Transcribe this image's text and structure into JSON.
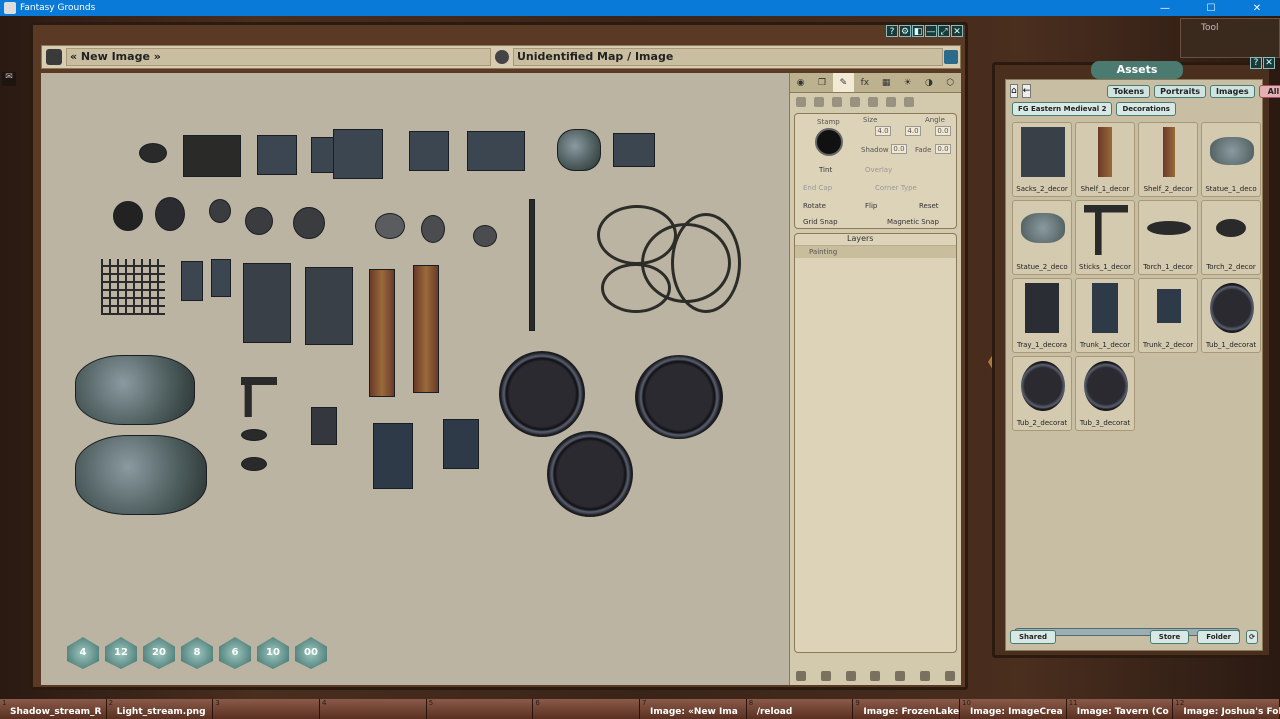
{
  "os_window": {
    "title": "Fantasy Grounds",
    "controls": [
      "—",
      "☐",
      "✕"
    ]
  },
  "image_window": {
    "name_field": "« New Image »",
    "type_field": "Unidentified Map / Image",
    "controls": [
      "?",
      "⚙",
      "◧",
      "—",
      "⤢",
      "✕"
    ]
  },
  "dice": [
    "4",
    "12",
    "20",
    "8",
    "6",
    "10",
    "00"
  ],
  "palette": {
    "stamp": {
      "stamp_label": "Stamp",
      "size_label": "Size",
      "angle_label": "Angle",
      "size_w": "4.0",
      "size_h": "4.0",
      "angle": "0.0",
      "shadow_label": "Shadow",
      "shadow": "0.0",
      "fade_label": "Fade",
      "fade": "0.0",
      "tint_label": "Tint",
      "overlay_label": "Overlay",
      "end_cap_label": "End Cap",
      "corner_type_label": "Corner Type",
      "rotate_label": "Rotate",
      "flip_label": "Flip",
      "reset_label": "Reset",
      "grid_snap_label": "Grid Snap",
      "magnetic_snap_label": "Magnetic Snap"
    },
    "layers": {
      "title": "Layers",
      "row": "Painting"
    }
  },
  "tool_panel": {
    "label": "Tool"
  },
  "assets": {
    "title": "Assets",
    "tabs": [
      "Tokens",
      "Portraits",
      "Images",
      "All"
    ],
    "breadcrumbs": [
      "FG Eastern Medieval 2",
      "Decorations"
    ],
    "items": [
      "Sacks_2_decor",
      "Shelf_1_decor",
      "Shelf_2_decor",
      "Statue_1_deco",
      "Statue_2_deco",
      "Sticks_1_decor",
      "Torch_1_decor",
      "Torch_2_decor",
      "Tray_1_decora",
      "Trunk_1_decor",
      "Trunk_2_decor",
      "Tub_1_decorat",
      "Tub_2_decorat",
      "Tub_3_decorat"
    ],
    "footer": {
      "shared": "Shared",
      "store": "Store",
      "folder": "Folder"
    }
  },
  "hotkeys": [
    {
      "num": "1",
      "label": "Shadow_stream_R"
    },
    {
      "num": "2",
      "label": "Light_stream.png"
    },
    {
      "num": "3",
      "label": ""
    },
    {
      "num": "4",
      "label": ""
    },
    {
      "num": "5",
      "label": ""
    },
    {
      "num": "6",
      "label": ""
    },
    {
      "num": "7",
      "label": "Image: «New Ima"
    },
    {
      "num": "8",
      "label": "/reload"
    },
    {
      "num": "9",
      "label": "Image: FrozenLake"
    },
    {
      "num": "10",
      "label": "Image: ImageCrea"
    },
    {
      "num": "11",
      "label": "Image: Tavern (Co"
    },
    {
      "num": "12",
      "label": "Image: Joshua's Foll"
    }
  ]
}
